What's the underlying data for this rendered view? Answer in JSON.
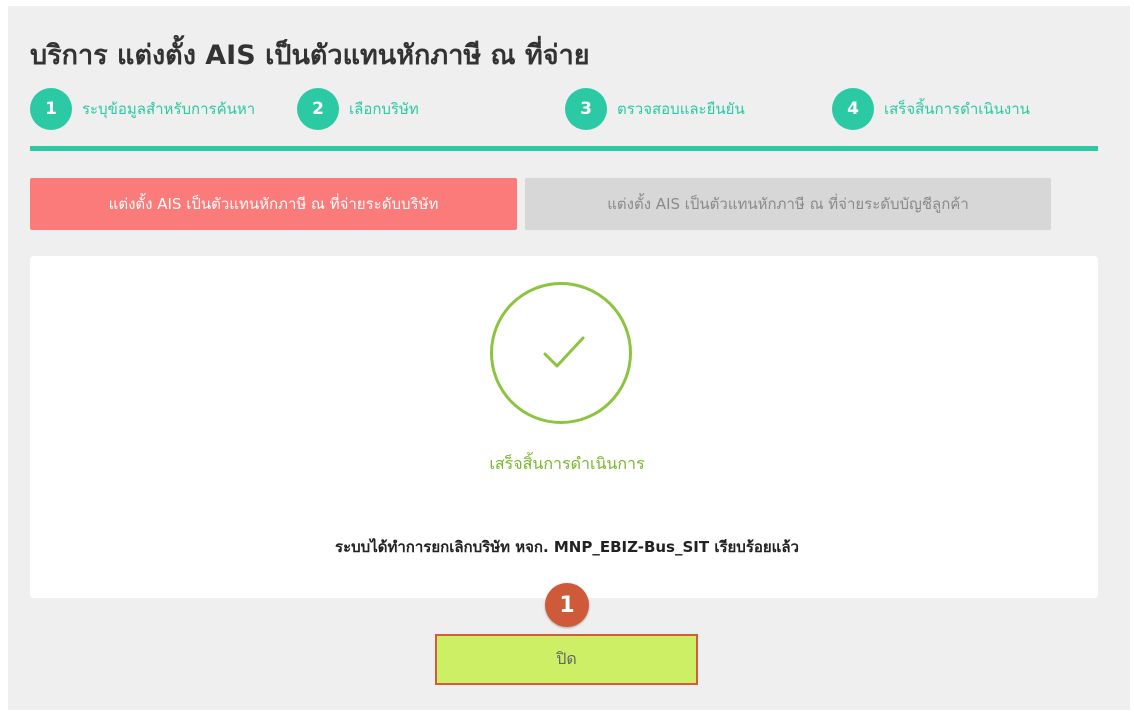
{
  "page": {
    "title": "บริการ แต่งตั้ง AIS เป็นตัวแทนหักภาษี ณ ที่จ่าย"
  },
  "steps": [
    {
      "number": "1",
      "label": "ระบุข้อมูลสำหรับการค้นหา"
    },
    {
      "number": "2",
      "label": "เลือกบริษัท"
    },
    {
      "number": "3",
      "label": "ตรวจสอบและยืนยัน"
    },
    {
      "number": "4",
      "label": "เสร็จสิ้นการดำเนินงาน"
    }
  ],
  "tabs": {
    "company": "แต่งตั้ง AIS เป็นตัวแทนหักภาษี ณ ที่จ่ายระดับบริษัท",
    "account": "แต่งตั้ง AIS เป็นตัวแทนหักภาษี ณ ที่จ่ายระดับบัญชีลูกค้า"
  },
  "result": {
    "icon": "check-icon",
    "status": "เสร็จสิ้นการดำเนินการ",
    "message": "ระบบได้ทำการยกเลิกบริษัท หจก. MNP_EBIZ-Bus_SIT เรียบร้อยแล้ว"
  },
  "annotation": {
    "badge_number": "1"
  },
  "buttons": {
    "close": "ปิด"
  },
  "colors": {
    "accent": "#2bc9a4",
    "active_tab": "#fb7b7b",
    "inactive_tab": "#d7d7d7",
    "success": "#8cc43f",
    "close_button": "#cdef66",
    "annotation": "#cf5a3a"
  }
}
